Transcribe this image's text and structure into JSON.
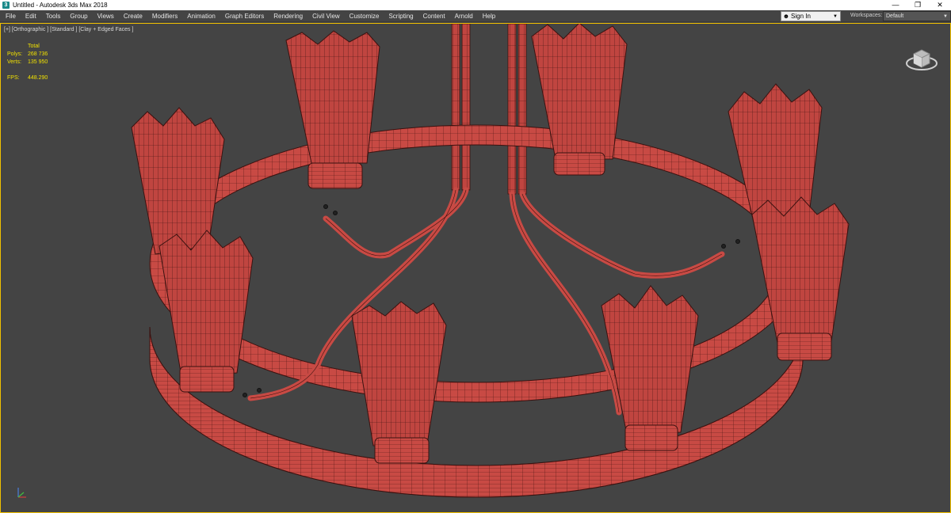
{
  "window": {
    "title": "Untitled - Autodesk 3ds Max 2018",
    "app_icon": "3",
    "controls": {
      "minimize": "—",
      "restore": "❐",
      "close": "✕"
    }
  },
  "menu": {
    "items": [
      {
        "label": "File"
      },
      {
        "label": "Edit"
      },
      {
        "label": "Tools"
      },
      {
        "label": "Group"
      },
      {
        "label": "Views"
      },
      {
        "label": "Create"
      },
      {
        "label": "Modifiers"
      },
      {
        "label": "Animation"
      },
      {
        "label": "Graph Editors"
      },
      {
        "label": "Rendering"
      },
      {
        "label": "Civil View"
      },
      {
        "label": "Customize"
      },
      {
        "label": "Scripting"
      },
      {
        "label": "Content"
      },
      {
        "label": "Arnold"
      },
      {
        "label": "Help"
      }
    ],
    "sign_in": "Sign In",
    "workspaces_label": "Workspaces:",
    "workspace_value": "Default"
  },
  "viewport": {
    "label": "[+] [Orthographic ] [Standard ] [Clay + Edged Faces ]",
    "stats": {
      "header": "Total",
      "polys_label": "Polys:",
      "polys_value": "268 736",
      "verts_label": "Verts:",
      "verts_value": "135 950",
      "fps_label": "FPS:",
      "fps_value": "448.290"
    },
    "colors": {
      "background": "#444444",
      "model": "#c84a44",
      "wire": "#3a1210",
      "active_border": "#f0c000"
    }
  }
}
